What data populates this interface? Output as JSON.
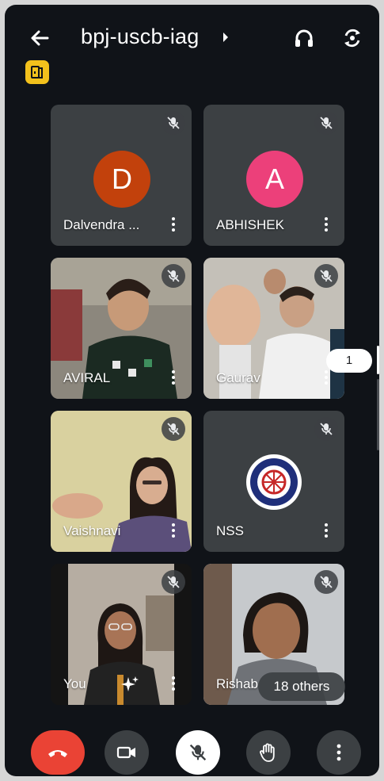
{
  "header": {
    "meeting_code": "bpj-uscb-iag",
    "back_icon": "arrow-left-icon",
    "headphone_icon": "headphones-icon",
    "switch_camera_icon": "switch-camera-icon",
    "host_icon": "host-controls-icon",
    "accent": "#f3c11c"
  },
  "participants": [
    {
      "name": "Dalvendra ...",
      "avatar_letter": "D",
      "avatar_color": "#c2410c",
      "muted": true
    },
    {
      "name": "ABHISHEK",
      "avatar_letter": "A",
      "avatar_color": "#ec407a",
      "muted": true
    },
    {
      "name": "AVIRAL",
      "muted": true
    },
    {
      "name": "Gaurav",
      "muted": true
    },
    {
      "name": "Vaishnavi",
      "muted": true
    },
    {
      "name": "NSS",
      "muted": true
    },
    {
      "name": "You",
      "muted": true
    },
    {
      "name": "Rishab"
    }
  ],
  "overlay": {
    "page_count": "1",
    "others_label": "18 others"
  },
  "controls": {
    "end_call_icon": "end-call-icon",
    "camera_icon": "video-camera-icon",
    "mic_icon": "mic-off-icon",
    "raise_hand_icon": "raise-hand-icon",
    "more_icon": "more-vert-icon",
    "end_call_color": "#ea4335"
  }
}
